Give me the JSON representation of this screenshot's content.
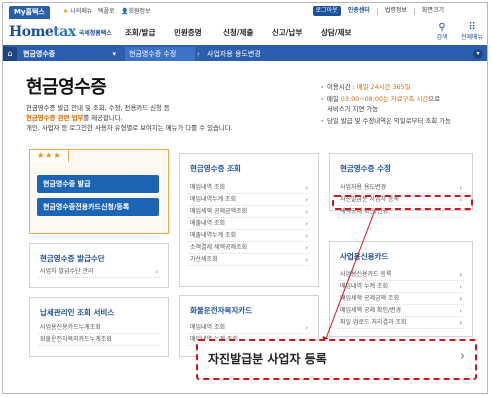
{
  "utility": {
    "my_tab": "My홈택스",
    "my_menu": "나의메뉴",
    "youtube": "텍플로",
    "member_info": "회원정보",
    "login": "로그아웃",
    "cert_center": "인증센터",
    "lang": "법령정보",
    "zoom": "화면크기"
  },
  "logo": {
    "mark_home": "Home",
    "mark_tax": "tax",
    "sub": "국세청홈택스"
  },
  "gnb": [
    "조회/발급",
    "민원증명",
    "신청/제출",
    "신고/납부",
    "상담/제보"
  ],
  "header_icons": [
    {
      "name": "search-icon",
      "glyph": "⚲",
      "label": "검색"
    },
    {
      "name": "all-menu-icon",
      "glyph": "⠿",
      "label": "전체메뉴"
    }
  ],
  "breadcrumb": {
    "section": "현금영수증",
    "item1": "현금영수증 수정",
    "item2": "사업자용 용도변경"
  },
  "page": {
    "title": "현금영수증",
    "intro_line1": "현금영수증 발급 안내 및 조회, 수정, 전용카드 신청 등",
    "intro_line2_hl": "현금영수증 관련 업무",
    "intro_line2_rest": "를 제공합니다.",
    "intro_line3": "개인, 사업자 등 로그인한 사용자 유형별로 보여지는 메뉴가 다를 수 있습니다."
  },
  "info": {
    "hours_label": "이용시간 : ",
    "hours_value": "매일 24시간 365일",
    "daily_prefix": "매일 ",
    "daily_hl": "03:00~08:00는 자료구축 시간",
    "daily_rest": "으로",
    "daily_line2": "서비스가 지연 가능",
    "note": "당일 발급 및 수정내역은 익일로부터 조회 가능"
  },
  "featured": {
    "stars": "★★★",
    "btn1": "현금영수증 발급",
    "btn2": "현금영수증전용카드신청/등록"
  },
  "boxes": {
    "inquiry": {
      "title": "현금영수증 조회",
      "items": [
        "매입내역 조회",
        "매입내역누계 조회",
        "매입세액 공제금액조회",
        "매출내역 조회",
        "매출내역누계 조회",
        "소액결제 세액공제조회",
        "가산세조회"
      ]
    },
    "modify": {
      "title": "현금영수증 수정",
      "items": [
        "사업자용 용도변경",
        "자진발급분 사업자 등록",
        "세액공제 확인/변경"
      ]
    },
    "issuer": {
      "title": "현금영수증 발급수단",
      "items": [
        "사업자 발급수단 관리"
      ]
    },
    "tax_association": {
      "title": "납세관리인 조회 서비스",
      "items": [
        "사업용신용카드누계조회",
        "화물운전자복지카드누계조회"
      ]
    },
    "business_card": {
      "title": "사업용신용카드",
      "items": [
        "사업용신용카드 등록",
        "매입내역 누계 조회",
        "매입세액 공제금액 조회",
        "매입세액 공제 확인/변경",
        "파일 업로드 처리결과 조회"
      ]
    },
    "freight_card": {
      "title": "화물운전자복지카드",
      "items": [
        "매입내역 조회",
        "매입내역 누계 조회"
      ]
    }
  },
  "zoom_callout": {
    "label": "자진발급분 사업자 등록"
  },
  "colors": {
    "brand": "#2b5fae",
    "accent": "#e06a00",
    "highlight": "#d4141b"
  }
}
